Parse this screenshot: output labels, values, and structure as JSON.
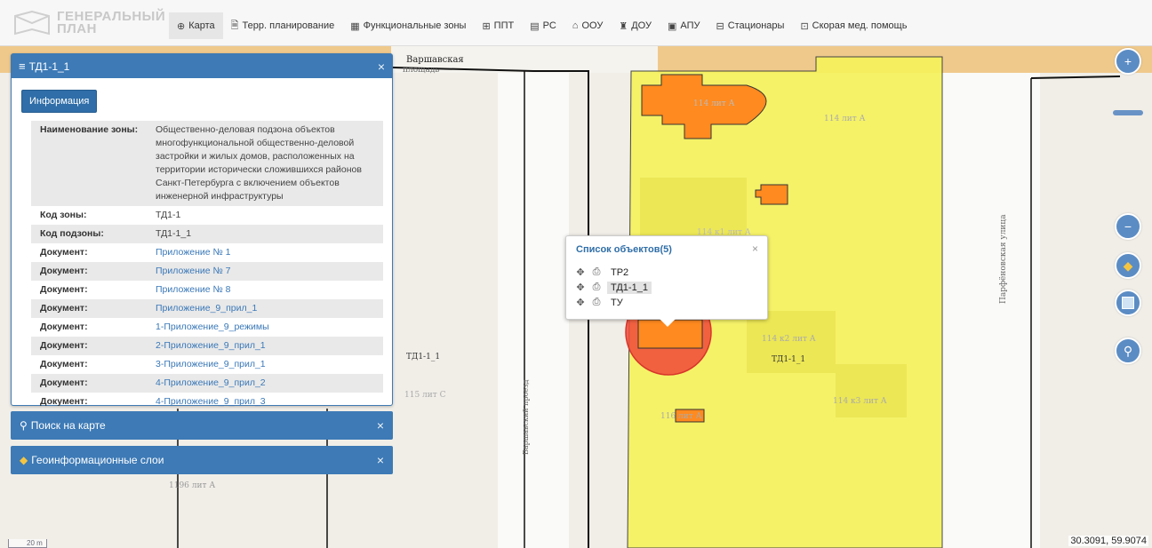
{
  "app": {
    "logo_line1": "ГЕНЕРАЛЬНЫЙ",
    "logo_line2": "ПЛАН"
  },
  "nav": [
    {
      "icon": "globe-icon",
      "glyph": "⊕",
      "label": "Карта"
    },
    {
      "icon": "document-icon",
      "glyph": "🗎",
      "label": "Терр. планирование"
    },
    {
      "icon": "grid-icon",
      "glyph": "▦",
      "label": "Функциональные зоны"
    },
    {
      "icon": "table-icon",
      "glyph": "⊞",
      "label": "ППТ"
    },
    {
      "icon": "doc-list-icon",
      "glyph": "▤",
      "label": "РС"
    },
    {
      "icon": "bank-icon",
      "glyph": "⌂",
      "label": "ООУ"
    },
    {
      "icon": "tree-icon",
      "glyph": "♜",
      "label": "ДОУ"
    },
    {
      "icon": "id-card-icon",
      "glyph": "▣",
      "label": "АПУ"
    },
    {
      "icon": "hospital-icon",
      "glyph": "⊟",
      "label": "Стационары"
    },
    {
      "icon": "ambulance-icon",
      "glyph": "⊡",
      "label": "Скорая мед. помощь"
    }
  ],
  "panel": {
    "title": "ТД1-1_1",
    "info_button": "Информация",
    "rows": [
      {
        "key": "Наименование зоны:",
        "value": "Общественно-деловая подзона объектов многофункциональной общественно-деловой застройки и жилых домов, расположенных на территории исторически сложившихся районов Санкт-Петербурга с включением объектов инженерной инфраструктуры",
        "link": false
      },
      {
        "key": "Код зоны:",
        "value": "ТД1-1",
        "link": false
      },
      {
        "key": "Код подзоны:",
        "value": "ТД1-1_1",
        "link": false
      },
      {
        "key": "Документ:",
        "value": "Приложение № 1",
        "link": true
      },
      {
        "key": "Документ:",
        "value": "Приложение № 7",
        "link": true
      },
      {
        "key": "Документ:",
        "value": "Приложение № 8",
        "link": true
      },
      {
        "key": "Документ:",
        "value": "Приложение_9_прил_1",
        "link": true
      },
      {
        "key": "Документ:",
        "value": "1-Приложение_9_режимы",
        "link": true
      },
      {
        "key": "Документ:",
        "value": "2-Приложение_9_прил_1",
        "link": true
      },
      {
        "key": "Документ:",
        "value": "3-Приложение_9_прил_1",
        "link": true
      },
      {
        "key": "Документ:",
        "value": "4-Приложение_9_прил_2",
        "link": true
      },
      {
        "key": "Документ:",
        "value": "4-Приложение_9_прил_3",
        "link": true
      }
    ]
  },
  "search_panel": {
    "label": "Поиск на карте"
  },
  "layers_panel": {
    "label": "Геоинформационные слои"
  },
  "popup": {
    "title": "Список объектов(5)",
    "items": [
      {
        "label": "ТР2",
        "selected": false
      },
      {
        "label": "ТД1-1_1",
        "selected": true
      },
      {
        "label": "ТУ",
        "selected": false
      }
    ]
  },
  "map": {
    "street_top": "Варшавская",
    "street_top2": "площадь",
    "street_right": "Парфёновская улица",
    "street_mid": "Варшавский проезд",
    "labels": [
      "114 лит А",
      "114 к2 лит А",
      "114 к3 лит А",
      "ТД1-1_1",
      "ТД1-1_1",
      "115 лит С",
      "116 лит А",
      "1196 лит А",
      "114 к1 лит А",
      "114 лит А"
    ],
    "scale": "20 m",
    "coords": "30.3091, 59.9074",
    "colors": {
      "zone": "#f5f25a",
      "building": "#ff8a1f",
      "highlight": "#f0483a",
      "panel": "#3d7ab6"
    }
  },
  "tools": {
    "zoom_in": "+",
    "zoom_out": "−"
  }
}
